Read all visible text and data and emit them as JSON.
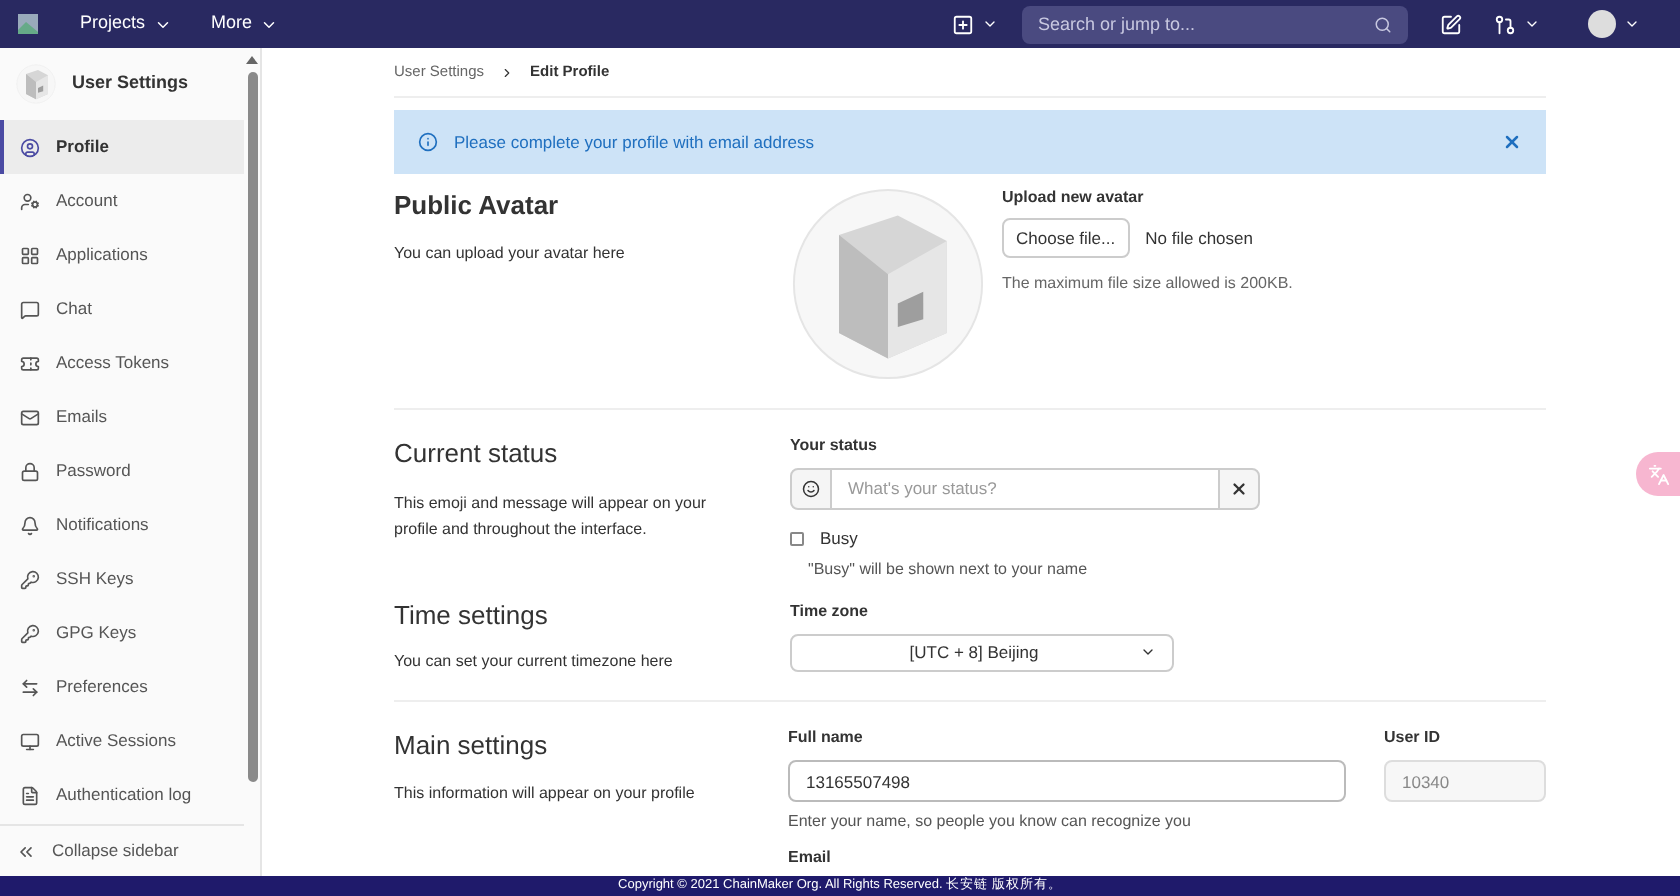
{
  "navbar": {
    "menus": [
      "Projects",
      "More"
    ],
    "search": {
      "placeholder": "Search or jump to..."
    }
  },
  "sidebar": {
    "title": "User Settings",
    "items": [
      {
        "label": "Profile",
        "selected": true
      },
      {
        "label": "Account",
        "selected": false
      },
      {
        "label": "Applications",
        "selected": false
      },
      {
        "label": "Chat",
        "selected": false
      },
      {
        "label": "Access Tokens",
        "selected": false
      },
      {
        "label": "Emails",
        "selected": false
      },
      {
        "label": "Password",
        "selected": false
      },
      {
        "label": "Notifications",
        "selected": false
      },
      {
        "label": "SSH Keys",
        "selected": false
      },
      {
        "label": "GPG Keys",
        "selected": false
      },
      {
        "label": "Preferences",
        "selected": false
      },
      {
        "label": "Active Sessions",
        "selected": false
      },
      {
        "label": "Authentication log",
        "selected": false
      }
    ],
    "collapse": "Collapse sidebar"
  },
  "breadcrumb": [
    "User Settings",
    "Edit Profile"
  ],
  "alert": "Please complete your profile with email address",
  "avatar": {
    "title": "Public Avatar",
    "description": "You can upload your avatar here",
    "upload_label": "Upload new avatar",
    "choose_button": "Choose file...",
    "file_status": "No file chosen",
    "hint": "The maximum file size allowed is 200KB."
  },
  "status": {
    "title": "Current status",
    "description": "This emoji and message will appear on your profile and throughout the interface.",
    "label": "Your status",
    "placeholder": "What's your status?",
    "busy": {
      "label": "Busy",
      "checked": false,
      "hint": "\"Busy\" will be shown next to your name"
    }
  },
  "time": {
    "title": "Time settings",
    "description": "You can set your current timezone here",
    "label": "Time zone",
    "value": "[UTC + 8] Beijing"
  },
  "main": {
    "title": "Main settings",
    "description": "This information will appear on your profile",
    "full_name_label": "Full name",
    "full_name": "13165507498",
    "full_name_hint": "Enter your name, so people you know can recognize you",
    "user_id_label": "User ID",
    "user_id": "10340",
    "email_label": "Email"
  },
  "footer": "Copyright © 2021 ChainMaker Org. All Rights Reserved. 长安链 版权所有。"
}
